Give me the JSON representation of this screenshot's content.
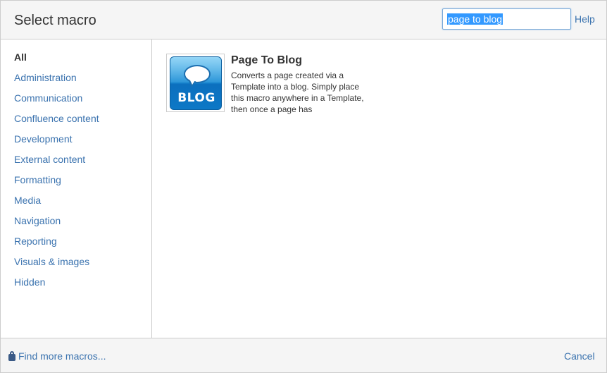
{
  "dialog": {
    "title": "Select macro",
    "search": {
      "value": "page to blog"
    },
    "help_label": "Help"
  },
  "sidebar": {
    "categories": [
      {
        "label": "All",
        "active": true
      },
      {
        "label": "Administration"
      },
      {
        "label": "Communication"
      },
      {
        "label": "Confluence content"
      },
      {
        "label": "Development"
      },
      {
        "label": "External content"
      },
      {
        "label": "Formatting"
      },
      {
        "label": "Media"
      },
      {
        "label": "Navigation"
      },
      {
        "label": "Reporting"
      },
      {
        "label": "Visuals & images"
      },
      {
        "label": "Hidden"
      }
    ]
  },
  "results": [
    {
      "name": "Page To Blog",
      "description": "Converts a page created via a Template into a blog. Simply place this macro anywhere in a Template, then once a page has",
      "icon": "blog-speech-bubble-icon",
      "icon_text": "BLOG"
    }
  ],
  "footer": {
    "find_more_label": "Find more macros...",
    "cancel_label": "Cancel"
  },
  "colors": {
    "link": "#3b73af",
    "header_bg": "#f5f5f5",
    "border": "#cccccc",
    "selection": "#3399ff"
  }
}
